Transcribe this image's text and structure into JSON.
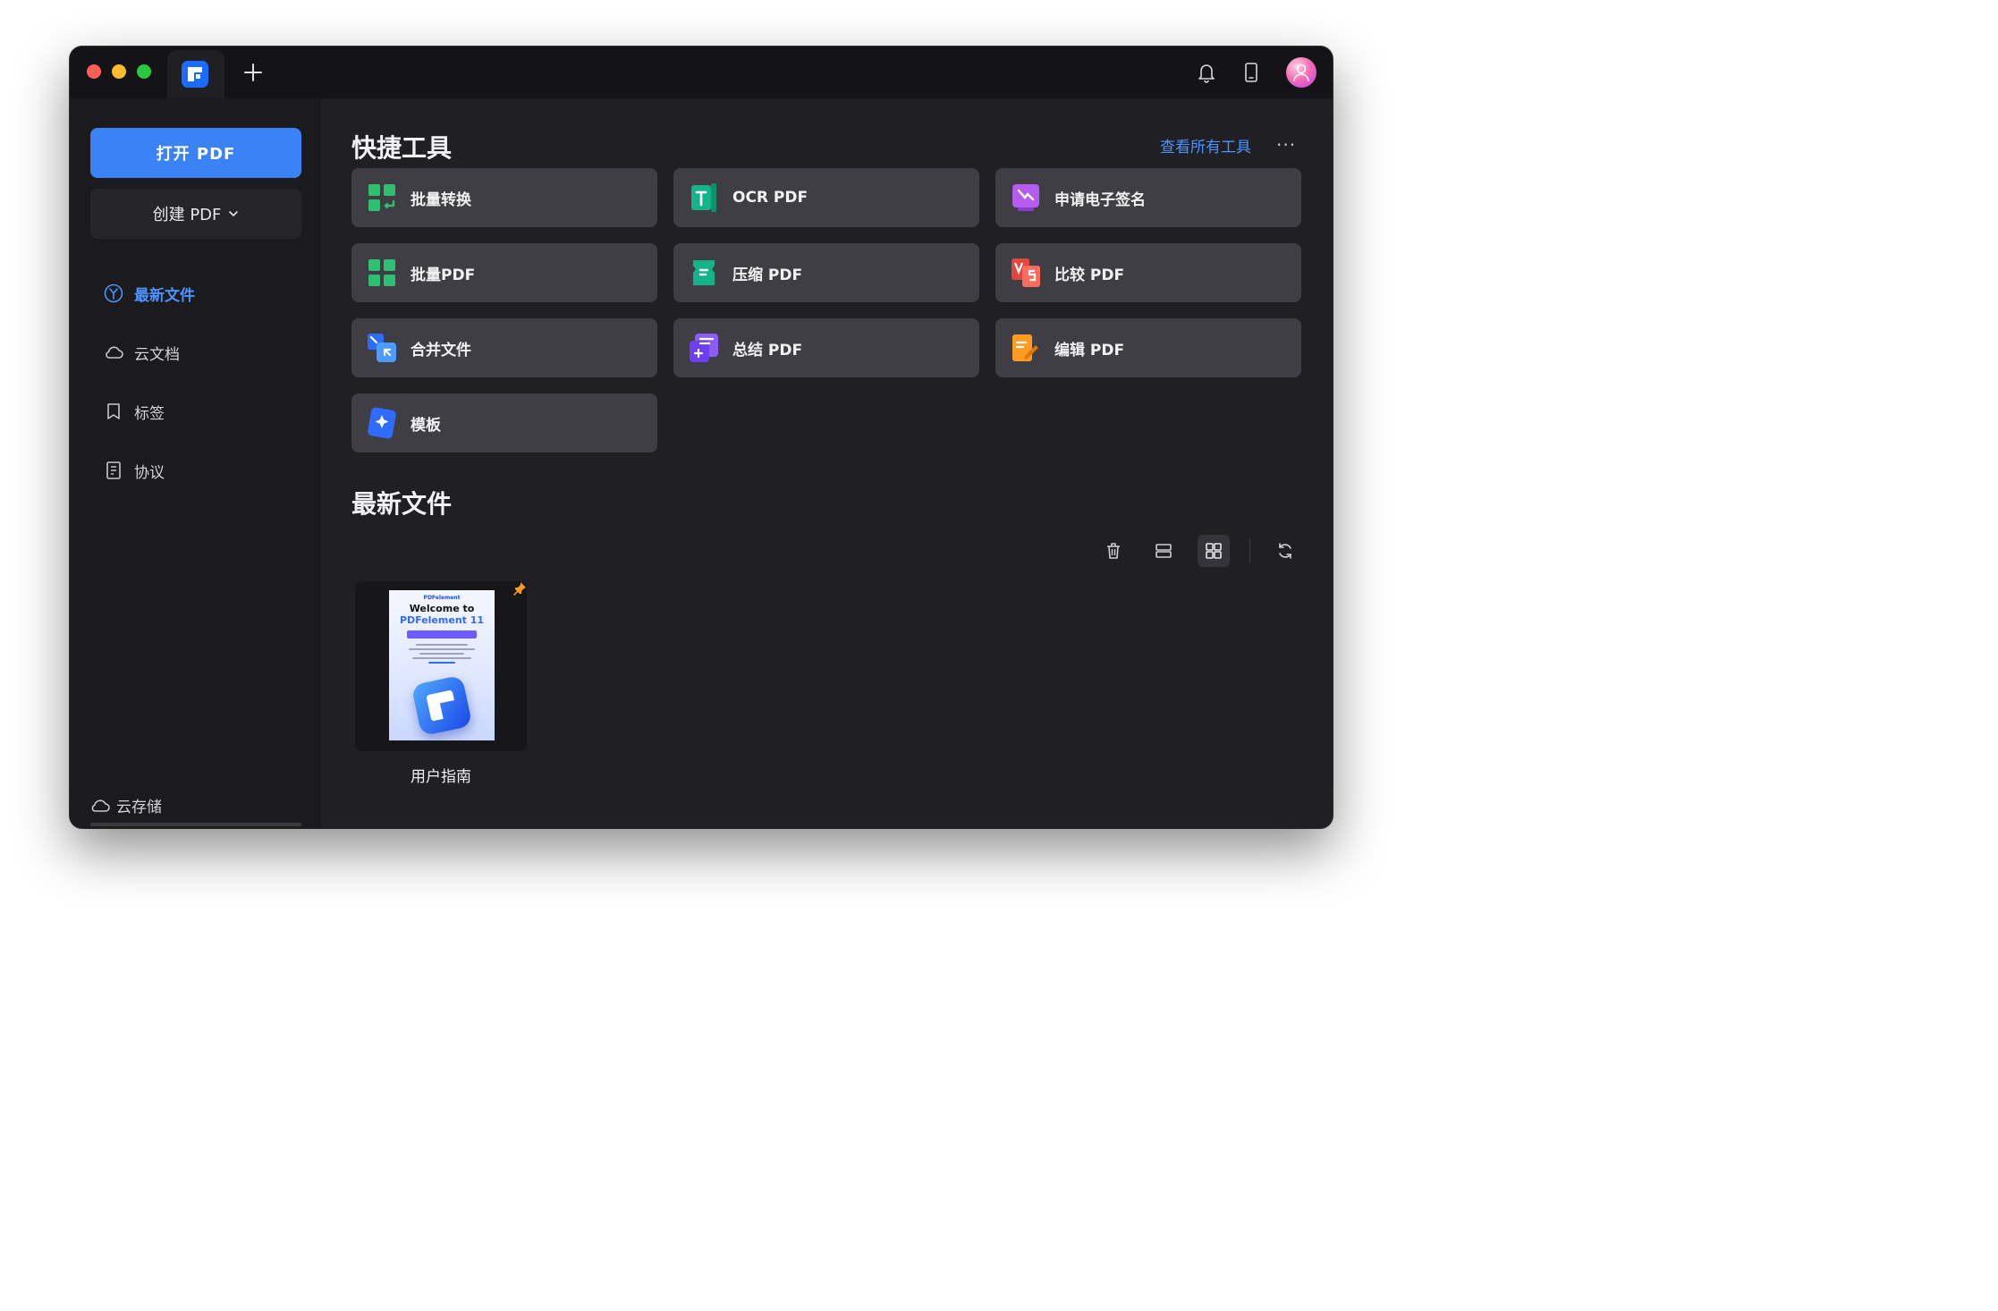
{
  "toolbar": {
    "new_tab": "+"
  },
  "sidebar": {
    "open_pdf": "打开 PDF",
    "create_pdf": "创建 PDF",
    "nav": [
      {
        "label": "最新文件",
        "icon": "recent-icon",
        "active": true
      },
      {
        "label": "云文档",
        "icon": "cloud-icon",
        "active": false
      },
      {
        "label": "标签",
        "icon": "bookmark-icon",
        "active": false
      },
      {
        "label": "协议",
        "icon": "document-icon",
        "active": false
      }
    ],
    "cloud_storage": "云存储"
  },
  "quick_tools": {
    "title": "快捷工具",
    "view_all": "查看所有工具",
    "more": "···",
    "items": [
      {
        "label": "批量转换",
        "icon": "batch-convert-icon"
      },
      {
        "label": "OCR PDF",
        "icon": "ocr-icon"
      },
      {
        "label": "申请电子签名",
        "icon": "esign-icon"
      },
      {
        "label": "批量PDF",
        "icon": "batch-pdf-icon"
      },
      {
        "label": "压缩 PDF",
        "icon": "compress-icon"
      },
      {
        "label": "比较 PDF",
        "icon": "compare-icon"
      },
      {
        "label": "合并文件",
        "icon": "merge-icon"
      },
      {
        "label": "总结 PDF",
        "icon": "summarize-icon"
      },
      {
        "label": "编辑 PDF",
        "icon": "edit-icon"
      },
      {
        "label": "模板",
        "icon": "template-icon"
      }
    ]
  },
  "recent": {
    "title": "最新文件",
    "files": [
      {
        "name": "用户指南",
        "thumb_brand": "PDFelement",
        "thumb_title_1": "Welcome to",
        "thumb_title_2": "PDFelement 11",
        "pinned": true
      }
    ]
  },
  "colors": {
    "accent": "#3a82f6",
    "link": "#4b93ff",
    "window_bg": "#1f1f24",
    "card_bg": "#3e3e44"
  }
}
